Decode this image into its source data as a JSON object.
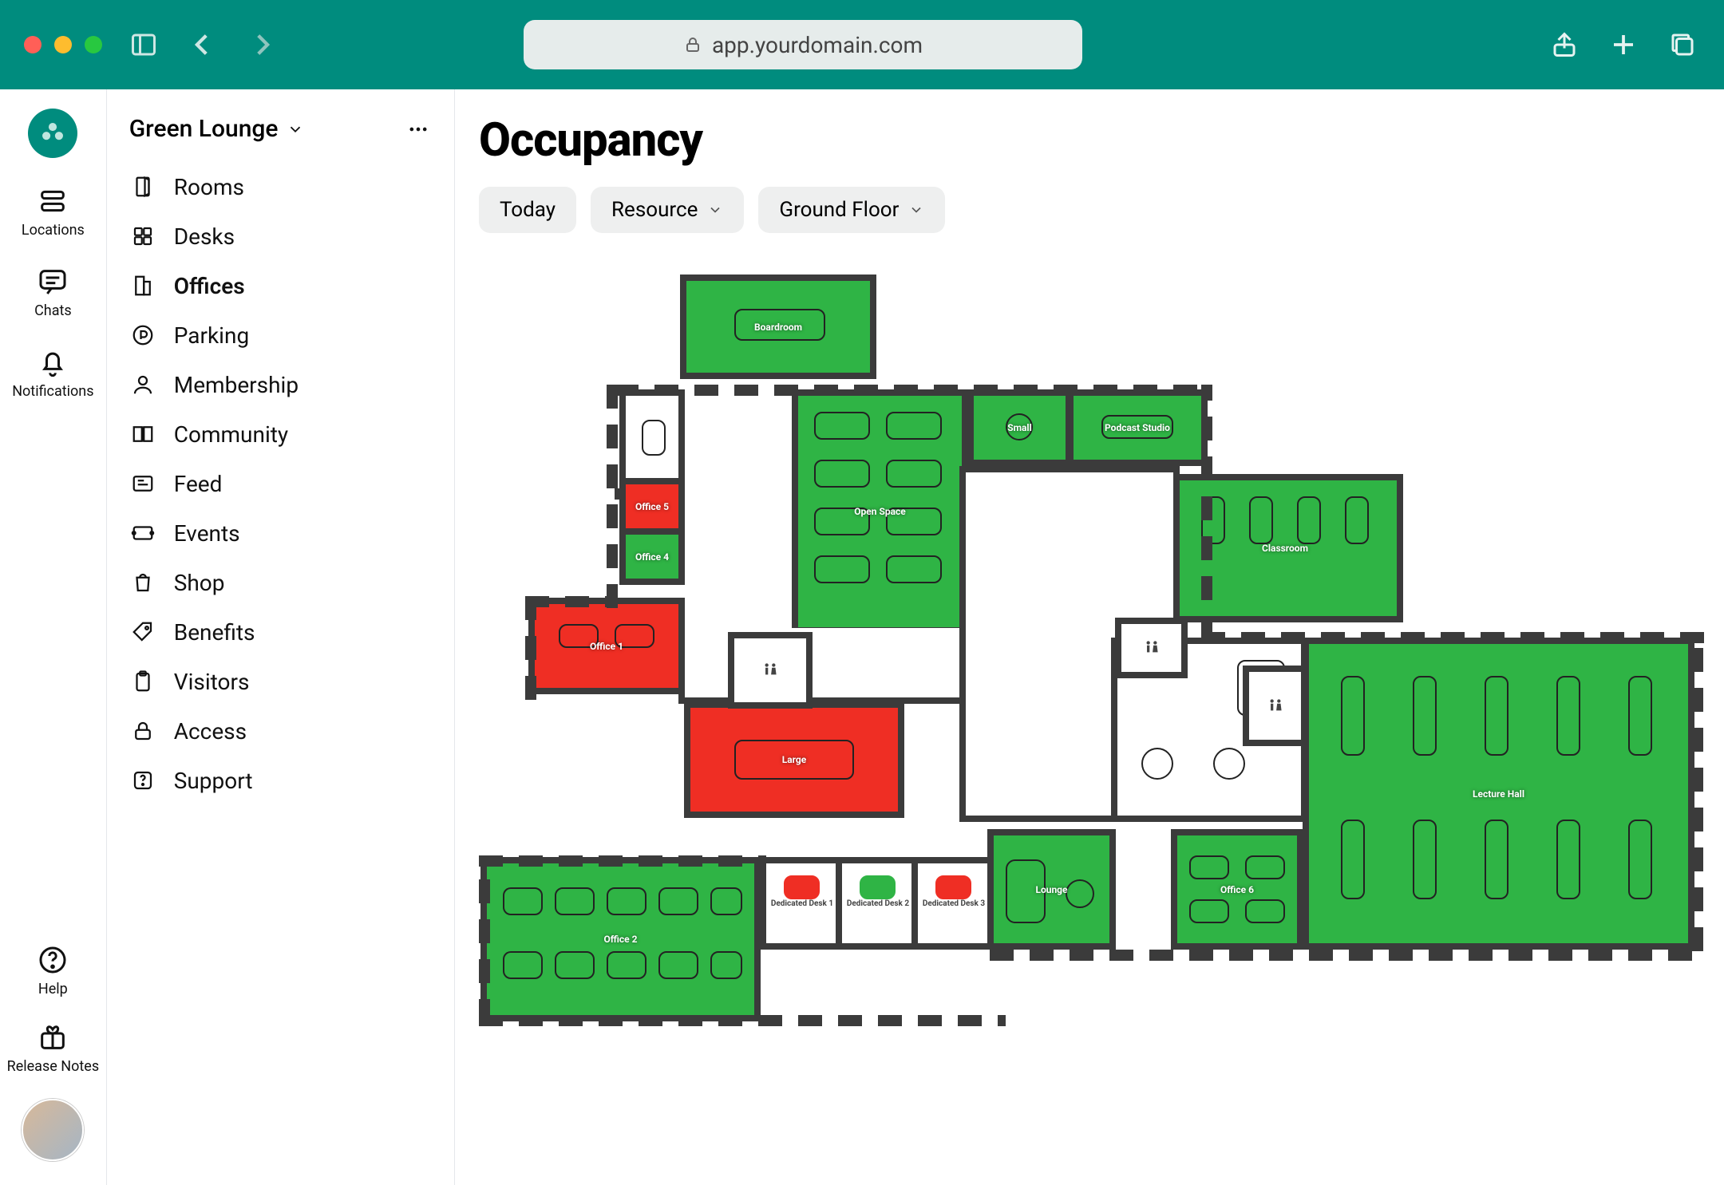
{
  "browser": {
    "url": "app.yourdomain.com"
  },
  "rail": {
    "items": [
      {
        "id": "locations",
        "label": "Locations"
      },
      {
        "id": "chats",
        "label": "Chats"
      },
      {
        "id": "notifications",
        "label": "Notifications"
      }
    ],
    "help_label": "Help",
    "release_notes_label": "Release Notes"
  },
  "sidebar": {
    "space_name": "Green Lounge",
    "nav": [
      {
        "id": "rooms",
        "label": "Rooms",
        "icon": "door"
      },
      {
        "id": "desks",
        "label": "Desks",
        "icon": "grid"
      },
      {
        "id": "offices",
        "label": "Offices",
        "icon": "office",
        "active": true
      },
      {
        "id": "parking",
        "label": "Parking",
        "icon": "parking"
      },
      {
        "id": "membership",
        "label": "Membership",
        "icon": "person"
      },
      {
        "id": "community",
        "label": "Community",
        "icon": "book"
      },
      {
        "id": "feed",
        "label": "Feed",
        "icon": "feed"
      },
      {
        "id": "events",
        "label": "Events",
        "icon": "ticket"
      },
      {
        "id": "shop",
        "label": "Shop",
        "icon": "bag"
      },
      {
        "id": "benefits",
        "label": "Benefits",
        "icon": "tag"
      },
      {
        "id": "visitors",
        "label": "Visitors",
        "icon": "clipboard"
      },
      {
        "id": "access",
        "label": "Access",
        "icon": "lock"
      },
      {
        "id": "support",
        "label": "Support",
        "icon": "question"
      }
    ]
  },
  "page": {
    "title": "Occupancy",
    "filters": {
      "today": "Today",
      "resource": "Resource",
      "floor": "Ground Floor"
    }
  },
  "floorplan": {
    "colors": {
      "available": "#2fb445",
      "occupied": "#ef2e24"
    },
    "rooms": [
      {
        "id": "boardroom",
        "label": "Boardroom",
        "status": "available"
      },
      {
        "id": "office5",
        "label": "Office 5",
        "status": "occupied"
      },
      {
        "id": "office4",
        "label": "Office 4",
        "status": "available"
      },
      {
        "id": "office1",
        "label": "Office 1",
        "status": "occupied"
      },
      {
        "id": "open_space",
        "label": "Open Space",
        "status": "available"
      },
      {
        "id": "small",
        "label": "Small",
        "status": "available"
      },
      {
        "id": "podcast",
        "label": "Podcast Studio",
        "status": "available"
      },
      {
        "id": "classroom",
        "label": "Classroom",
        "status": "available"
      },
      {
        "id": "large",
        "label": "Large",
        "status": "occupied"
      },
      {
        "id": "office2",
        "label": "Office 2",
        "status": "available"
      },
      {
        "id": "lecture_hall",
        "label": "Lecture Hall",
        "status": "available"
      },
      {
        "id": "lounge",
        "label": "Lounge",
        "status": "available"
      },
      {
        "id": "office6",
        "label": "Office 6",
        "status": "available"
      },
      {
        "id": "dd1",
        "label": "Dedicated Desk 1",
        "status": "occupied"
      },
      {
        "id": "dd2",
        "label": "Dedicated Desk 2",
        "status": "available"
      },
      {
        "id": "dd3",
        "label": "Dedicated Desk 3",
        "status": "occupied"
      }
    ]
  }
}
